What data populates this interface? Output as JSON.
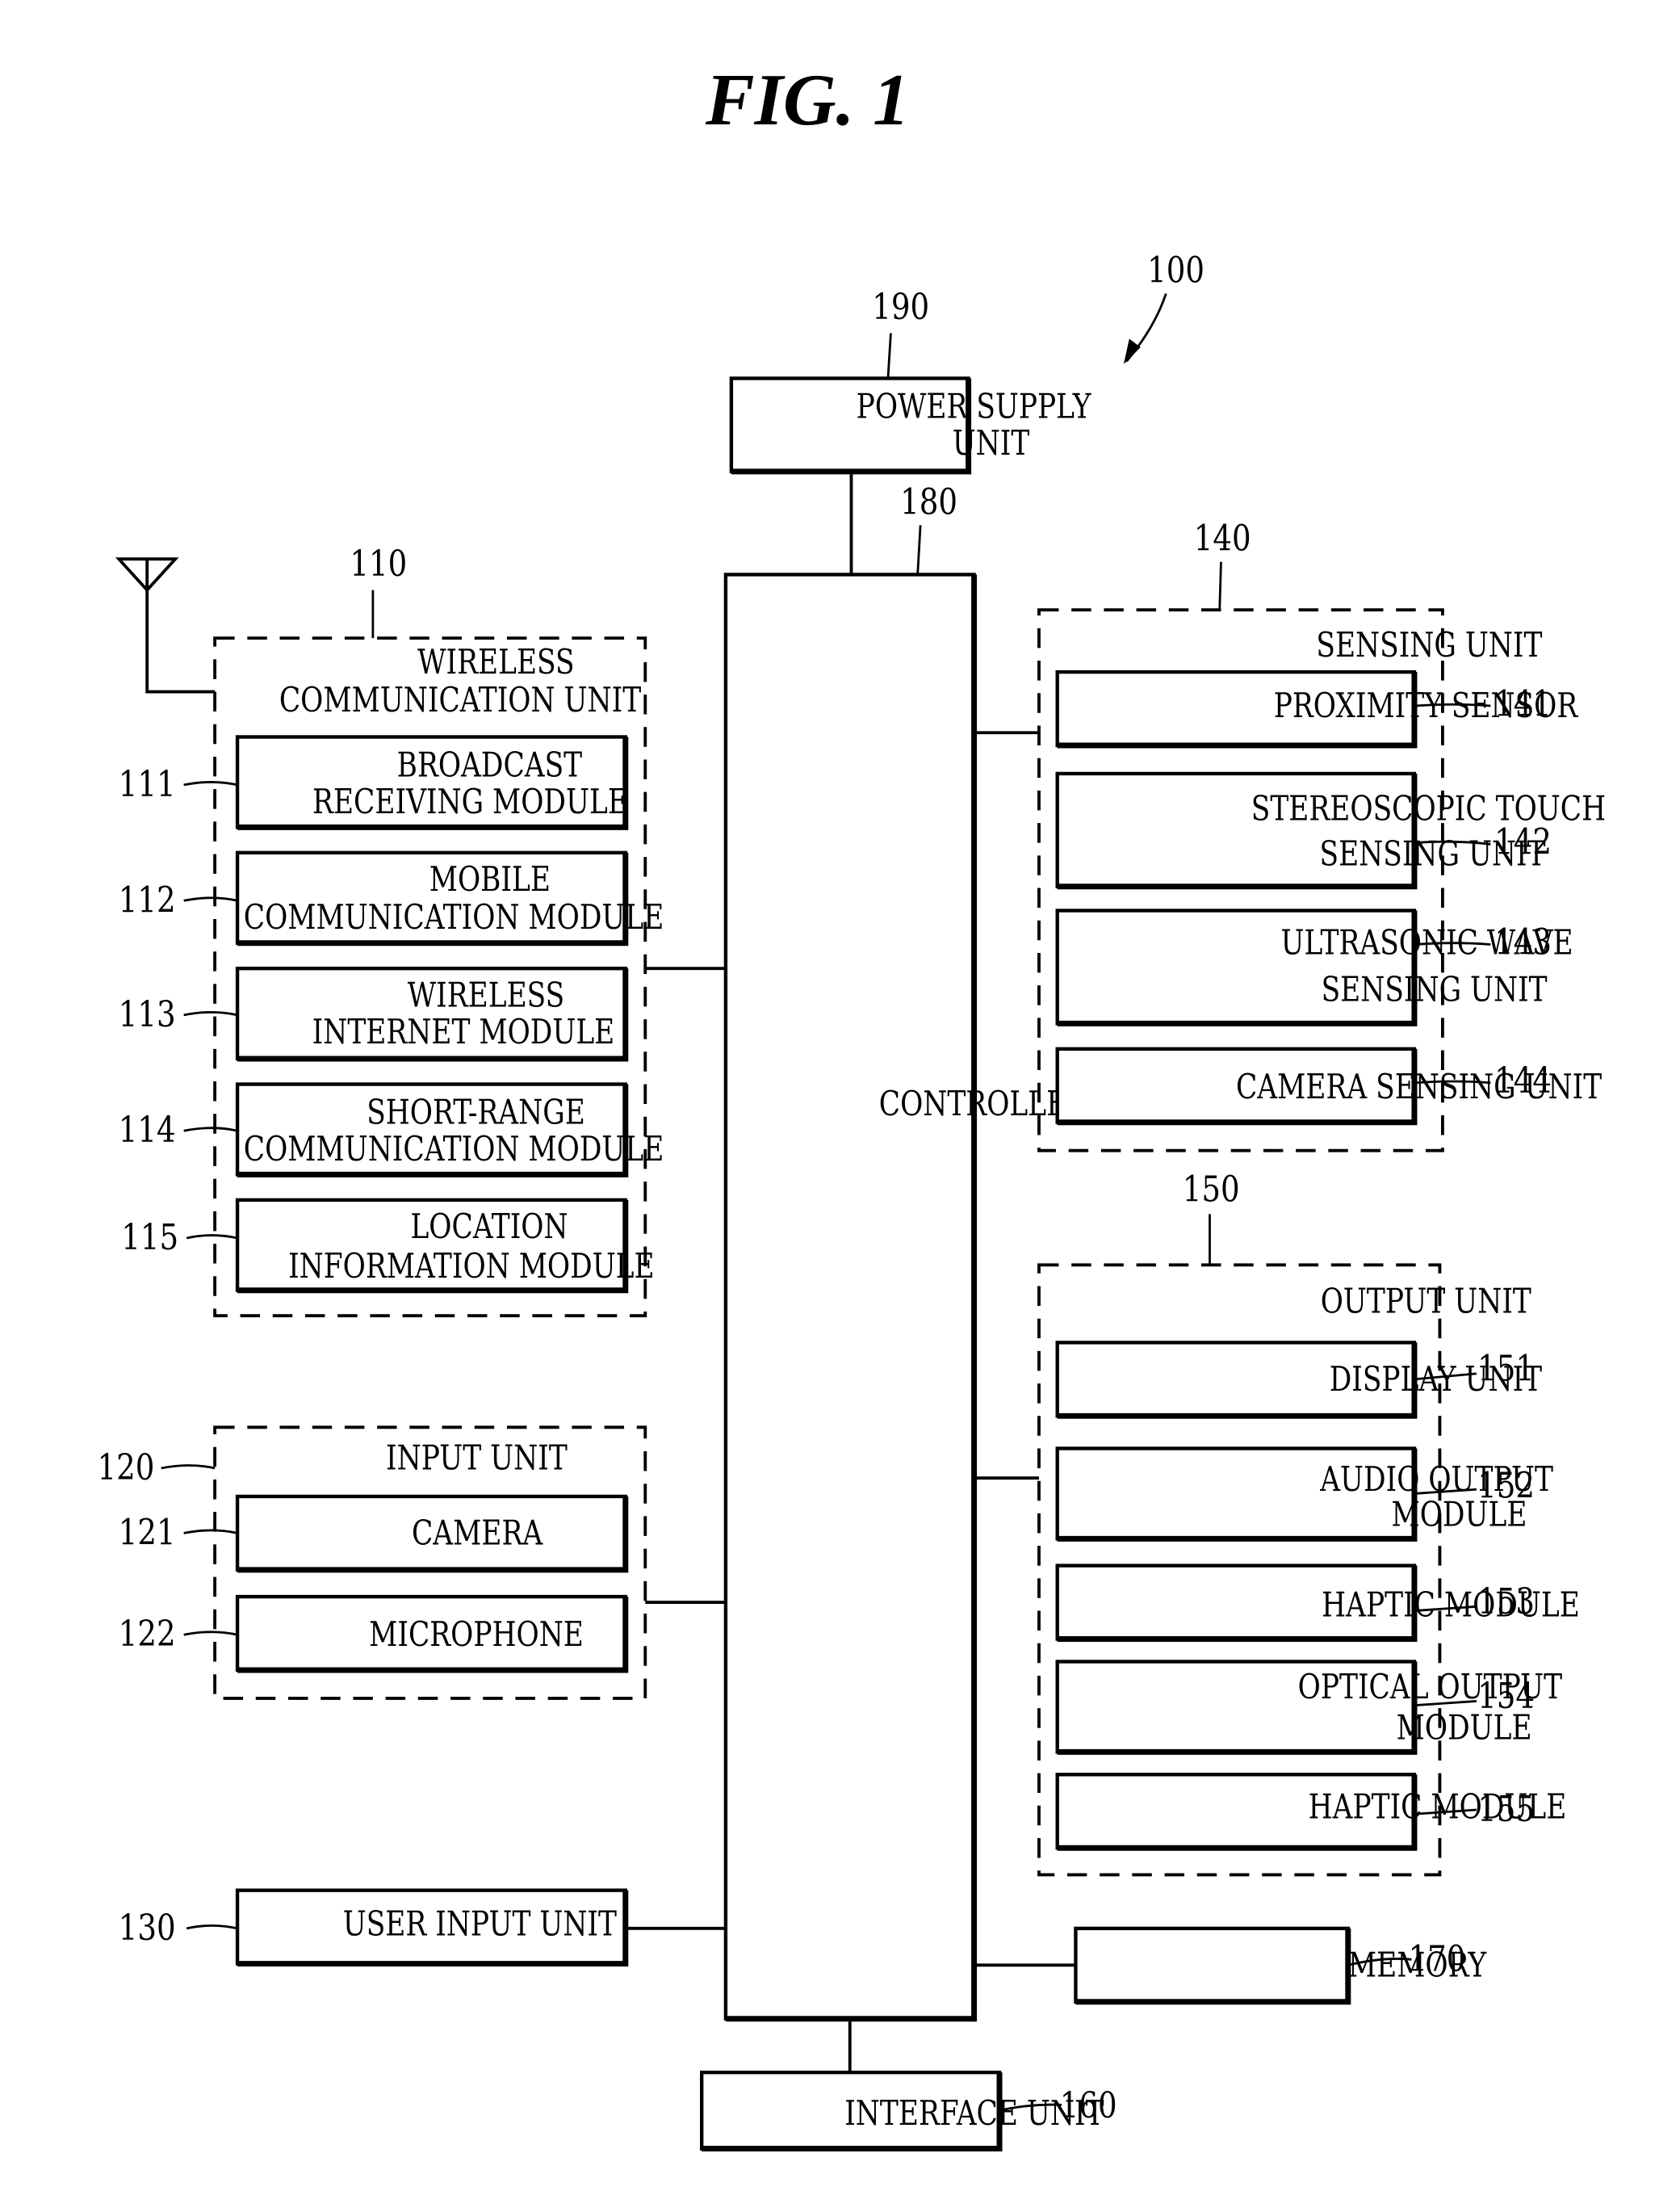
{
  "figure": {
    "title": "FIG. 1",
    "device_ref": "100"
  },
  "power_supply": {
    "ref": "190",
    "lines": [
      "POWER SUPPLY",
      "UNIT"
    ]
  },
  "controller": {
    "ref": "180",
    "label": "CONTROLLER"
  },
  "wireless_unit": {
    "ref": "110",
    "lines": [
      "WIRELESS",
      "COMMUNICATION UNIT"
    ],
    "modules": [
      {
        "ref": "111",
        "lines": [
          "BROADCAST",
          "RECEIVING MODULE"
        ]
      },
      {
        "ref": "112",
        "lines": [
          "MOBILE",
          "COMMUNICATION MODULE"
        ]
      },
      {
        "ref": "113",
        "lines": [
          "WIRELESS",
          "INTERNET MODULE"
        ]
      },
      {
        "ref": "114",
        "lines": [
          "SHORT-RANGE",
          "COMMUNICATION MODULE"
        ]
      },
      {
        "ref": "115",
        "lines": [
          "LOCATION",
          "INFORMATION MODULE"
        ]
      }
    ]
  },
  "input_unit": {
    "ref": "120",
    "label": "INPUT UNIT",
    "modules": [
      {
        "ref": "121",
        "label": "CAMERA"
      },
      {
        "ref": "122",
        "label": "MICROPHONE"
      }
    ]
  },
  "user_input_unit": {
    "ref": "130",
    "label": "USER INPUT UNIT"
  },
  "sensing_unit": {
    "ref": "140",
    "label": "SENSING UNIT",
    "modules": [
      {
        "ref": "141",
        "lines": [
          "PROXIMITY SENSOR"
        ]
      },
      {
        "ref": "142",
        "lines": [
          "STEREOSCOPIC TOUCH",
          "SENSING UNIT"
        ]
      },
      {
        "ref": "143",
        "lines": [
          "ULTRASONIC WAVE",
          "SENSING UNIT"
        ]
      },
      {
        "ref": "144",
        "lines": [
          "CAMERA SENSING UNIT"
        ]
      }
    ]
  },
  "output_unit": {
    "ref": "150",
    "label": "OUTPUT UNIT",
    "modules": [
      {
        "ref": "151",
        "lines": [
          "DISPLAY UNIT"
        ]
      },
      {
        "ref": "152",
        "lines": [
          "AUDIO OUTPUT",
          "MODULE"
        ]
      },
      {
        "ref": "153",
        "lines": [
          "HAPTIC MODULE"
        ]
      },
      {
        "ref": "154",
        "lines": [
          "OPTICAL OUTPUT",
          "MODULE"
        ]
      },
      {
        "ref": "155",
        "lines": [
          "HAPTIC MODULE"
        ]
      }
    ]
  },
  "interface_unit": {
    "ref": "160",
    "label": "INTERFACE UNIT"
  },
  "memory": {
    "ref": "170",
    "label": "MEMORY"
  }
}
